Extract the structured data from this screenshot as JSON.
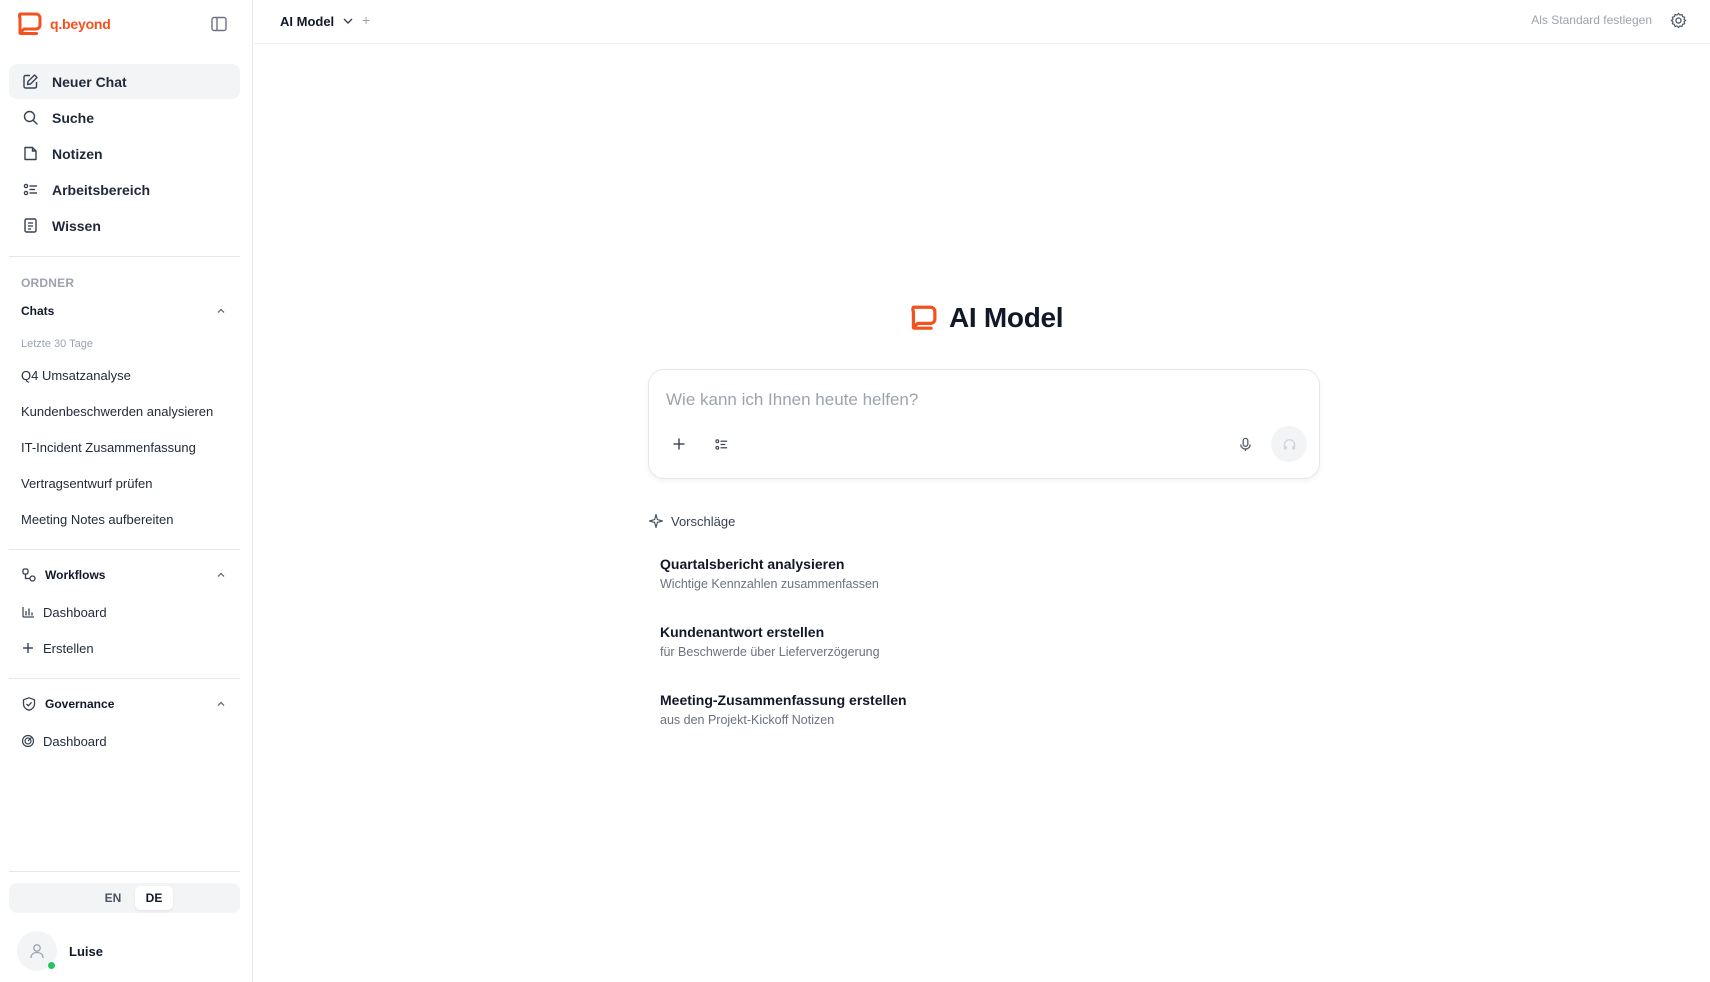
{
  "brand": {
    "name": "q.beyond",
    "color": "#f4511e"
  },
  "sidebar": {
    "nav": [
      {
        "label": "Neuer Chat",
        "icon": "edit-icon",
        "active": true
      },
      {
        "label": "Suche",
        "icon": "search-icon"
      },
      {
        "label": "Notizen",
        "icon": "note-icon"
      },
      {
        "label": "Arbeitsbereich",
        "icon": "workspace-icon"
      },
      {
        "label": "Wissen",
        "icon": "book-icon"
      }
    ],
    "folder_label": "ORDNER",
    "chats": {
      "label": "Chats",
      "period": "Letzte 30 Tage",
      "items": [
        "Q4 Umsatzanalyse",
        "Kundenbeschwerden analysieren",
        "IT-Incident Zusammenfassung",
        "Vertragsentwurf prüfen",
        "Meeting Notes aufbereiten"
      ]
    },
    "workflows": {
      "label": "Workflows",
      "items": [
        {
          "label": "Dashboard",
          "icon": "bar-chart-icon"
        },
        {
          "label": "Erstellen",
          "icon": "plus-icon"
        }
      ]
    },
    "governance": {
      "label": "Governance",
      "items": [
        {
          "label": "Dashboard",
          "icon": "radar-icon"
        }
      ]
    },
    "language": {
      "options": [
        "EN",
        "DE"
      ],
      "selected": "DE"
    },
    "user": {
      "name": "Luise",
      "status_color": "#22c55e"
    }
  },
  "topbar": {
    "model": "AI Model",
    "add": "+",
    "set_default": "Als Standard festlegen"
  },
  "main": {
    "title": "AI Model",
    "composer": {
      "placeholder": "Wie kann ich Ihnen heute helfen?",
      "value": ""
    },
    "suggestions_label": "Vorschläge",
    "suggestions": [
      {
        "title": "Quartalsbericht analysieren",
        "subtitle": "Wichtige Kennzahlen zusammenfassen"
      },
      {
        "title": "Kundenantwort erstellen",
        "subtitle": "für Beschwerde über Lieferverzögerung"
      },
      {
        "title": "Meeting-Zusammenfassung erstellen",
        "subtitle": "aus den Projekt-Kickoff Notizen"
      }
    ]
  }
}
